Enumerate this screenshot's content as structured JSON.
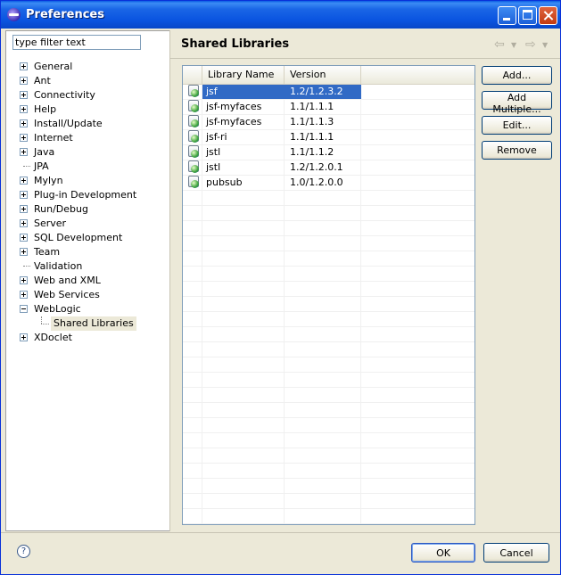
{
  "window": {
    "title": "Preferences"
  },
  "filter": {
    "value": "type filter text"
  },
  "tree": {
    "items": [
      {
        "label": "General",
        "expander": "plus"
      },
      {
        "label": "Ant",
        "expander": "plus"
      },
      {
        "label": "Connectivity",
        "expander": "plus"
      },
      {
        "label": "Help",
        "expander": "plus"
      },
      {
        "label": "Install/Update",
        "expander": "plus"
      },
      {
        "label": "Internet",
        "expander": "plus"
      },
      {
        "label": "Java",
        "expander": "plus"
      },
      {
        "label": "JPA",
        "expander": "none"
      },
      {
        "label": "Mylyn",
        "expander": "plus"
      },
      {
        "label": "Plug-in Development",
        "expander": "plus"
      },
      {
        "label": "Run/Debug",
        "expander": "plus"
      },
      {
        "label": "Server",
        "expander": "plus"
      },
      {
        "label": "SQL Development",
        "expander": "plus"
      },
      {
        "label": "Team",
        "expander": "plus"
      },
      {
        "label": "Validation",
        "expander": "none"
      },
      {
        "label": "Web and XML",
        "expander": "plus"
      },
      {
        "label": "Web Services",
        "expander": "plus"
      },
      {
        "label": "WebLogic",
        "expander": "minus"
      },
      {
        "label": "Shared Libraries",
        "expander": "child",
        "selected": true
      },
      {
        "label": "XDoclet",
        "expander": "plus"
      }
    ]
  },
  "page": {
    "title": "Shared Libraries"
  },
  "nav": {
    "back": "⇦",
    "forward": "⇨",
    "dropdown": "▼"
  },
  "table": {
    "columns": [
      "Library Name",
      "Version"
    ],
    "rows": [
      {
        "name": "jsf",
        "version": "1.2/1.2.3.2",
        "selected": true
      },
      {
        "name": "jsf-myfaces",
        "version": "1.1/1.1.1"
      },
      {
        "name": "jsf-myfaces",
        "version": "1.1/1.1.3"
      },
      {
        "name": "jsf-ri",
        "version": "1.1/1.1.1"
      },
      {
        "name": "jstl",
        "version": "1.1/1.1.2"
      },
      {
        "name": "jstl",
        "version": "1.2/1.2.0.1"
      },
      {
        "name": "pubsub",
        "version": "1.0/1.2.0.0"
      }
    ]
  },
  "buttons": {
    "add": "Add...",
    "add_multiple": "Add Multiple...",
    "edit": "Edit...",
    "remove": "Remove",
    "ok": "OK",
    "cancel": "Cancel"
  },
  "help": {
    "glyph": "?"
  },
  "colors": {
    "selection": "#316ac5",
    "titlebar": "#0a54e0",
    "dialog_bg": "#ece9d8"
  }
}
